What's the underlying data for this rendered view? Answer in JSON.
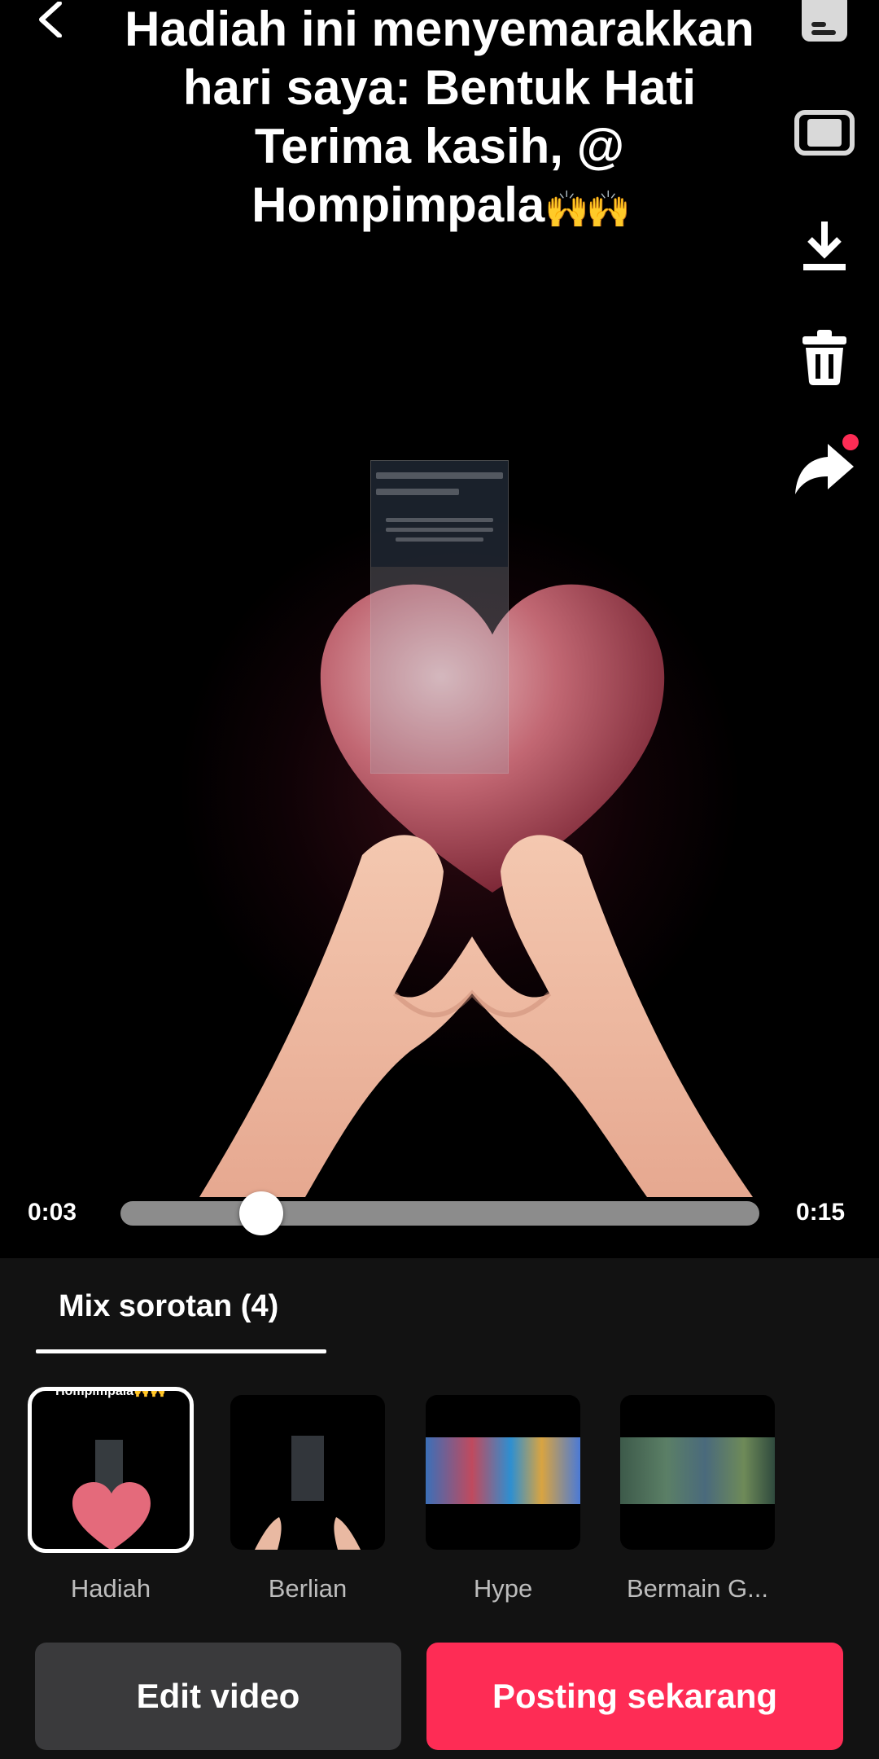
{
  "caption": {
    "text": "Hadiah ini menyemarakkan hari saya: Bentuk Hati Terima kasih, @ Hompimpala",
    "emoji": "🙌🙌"
  },
  "icons": {
    "back": "chevron-left-icon",
    "info": "info-card-icon",
    "aspect": "aspect-ratio-icon",
    "download": "download-icon",
    "delete": "trash-icon",
    "share": "share-arrow-icon"
  },
  "player": {
    "current_time": "0:03",
    "total_time": "0:15",
    "progress_fraction": 0.2
  },
  "highlights": {
    "tab_label": "Mix sorotan (4)",
    "clips": [
      {
        "label": "Hadiah",
        "selected": true,
        "thumb_text": "Hompimpala🙌🙌"
      },
      {
        "label": "Berlian",
        "selected": false
      },
      {
        "label": "Hype",
        "selected": false
      },
      {
        "label": "Bermain G..."
      }
    ]
  },
  "actions": {
    "edit_label": "Edit video",
    "post_label": "Posting sekarang"
  },
  "colors": {
    "accent": "#fe2c55",
    "panel_bg": "#121212",
    "secondary_button": "#3a3a3c",
    "notification_dot": "#fe2c55"
  }
}
